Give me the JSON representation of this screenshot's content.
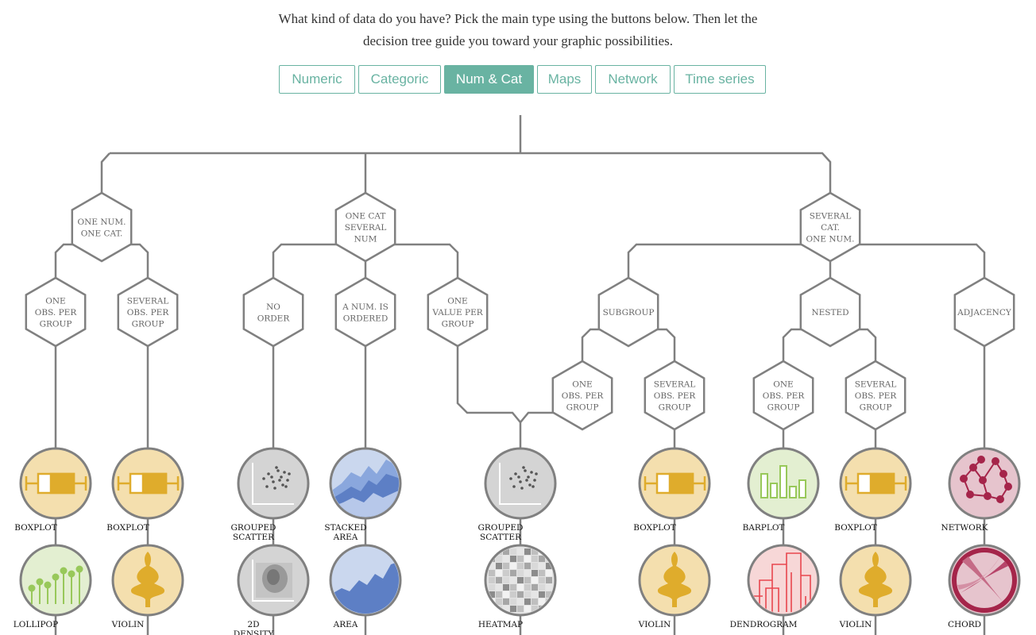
{
  "intro": {
    "line1": "What kind of data do you have? Pick the main type using the buttons below. Then let the",
    "line2": "decision tree guide you toward your graphic possibilities."
  },
  "tabs": [
    {
      "label": "Numeric",
      "active": false
    },
    {
      "label": "Categoric",
      "active": false
    },
    {
      "label": "Num & Cat",
      "active": true
    },
    {
      "label": "Maps",
      "active": false
    },
    {
      "label": "Network",
      "active": false
    },
    {
      "label": "Time series",
      "active": false
    }
  ],
  "colors": {
    "accent": "#69b3a2",
    "line": "#808080",
    "boxplot_bg": "#f4dfae",
    "boxplot_fg": "#dfac2c",
    "lollipop_bg": "#e3efd1",
    "lollipop_fg": "#98c85a",
    "scatter_bg": "#d4d4d4",
    "area_bg": "#cad7ee",
    "area_fg": "#5d7fc5",
    "barplot_bg": "#e3efd1",
    "dendro_bg": "#f7d7d7",
    "dendro_fg": "#e8464e",
    "network_bg": "#e6c4cd",
    "network_fg": "#a5254a"
  },
  "nodes": {
    "one_num_one_cat": [
      "ONE NUM.",
      "ONE CAT."
    ],
    "one_cat_several_num": [
      "ONE CAT",
      "SEVERAL",
      "NUM"
    ],
    "several_cat_one_num": [
      "SEVERAL",
      "CAT.",
      "ONE NUM."
    ],
    "one_obs_per_group_a": [
      "ONE",
      "OBS. PER",
      "GROUP"
    ],
    "several_obs_per_group_a": [
      "SEVERAL",
      "OBS. PER",
      "GROUP"
    ],
    "no_order": [
      "NO",
      "ORDER"
    ],
    "a_num_is_ordered": [
      "A NUM. IS",
      "ORDERED"
    ],
    "one_value_per_group": [
      "ONE",
      "VALUE PER",
      "GROUP"
    ],
    "subgroup": [
      "SUBGROUP"
    ],
    "nested": [
      "NESTED"
    ],
    "adjacency": [
      "ADJACENCY"
    ],
    "one_obs_per_group_b": [
      "ONE",
      "OBS. PER",
      "GROUP"
    ],
    "several_obs_per_group_b": [
      "SEVERAL",
      "OBS. PER",
      "GROUP"
    ],
    "one_obs_per_group_c": [
      "ONE",
      "OBS. PER",
      "GROUP"
    ],
    "several_obs_per_group_c": [
      "SEVERAL",
      "OBS. PER",
      "GROUP"
    ]
  },
  "leaves": {
    "boxplot_1": [
      "BOXPLOT"
    ],
    "boxplot_2": [
      "BOXPLOT"
    ],
    "grouped_scatter_1": [
      "GROUPED",
      "SCATTER"
    ],
    "stacked_area": [
      "STACKED",
      "AREA"
    ],
    "grouped_scatter_2": [
      "GROUPED",
      "SCATTER"
    ],
    "boxplot_3": [
      "BOXPLOT"
    ],
    "barplot": [
      "BARPLOT"
    ],
    "boxplot_4": [
      "BOXPLOT"
    ],
    "network": [
      "NETWORK"
    ],
    "lollipop": [
      "LOLLIPOP"
    ],
    "violin_1": [
      "VIOLIN"
    ],
    "density_2d": [
      "2D",
      "DENSITY"
    ],
    "area": [
      "AREA"
    ],
    "heatmap": [
      "HEATMAP"
    ],
    "violin_2": [
      "VIOLIN"
    ],
    "dendrogram": [
      "DENDROGRAM"
    ],
    "violin_3": [
      "VIOLIN"
    ],
    "chord": [
      "CHORD"
    ]
  }
}
